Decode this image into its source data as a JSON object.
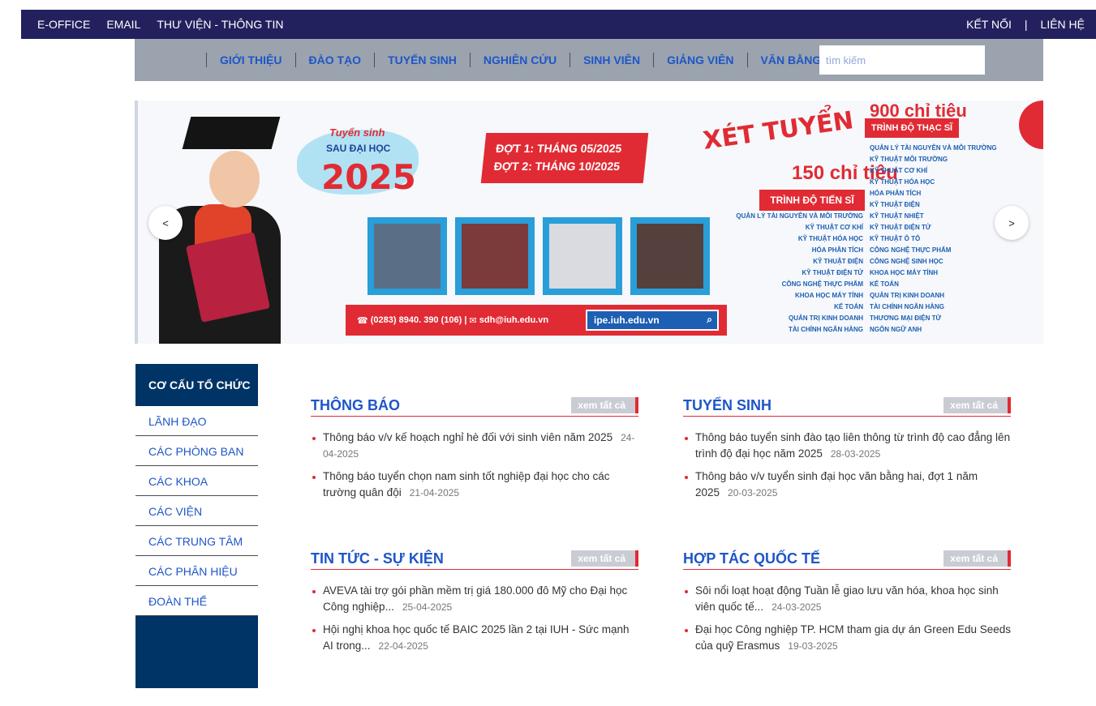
{
  "topbar": {
    "left": [
      "E-OFFICE",
      "EMAIL",
      "THƯ VIỆN - THÔNG TIN"
    ],
    "right": [
      "KẾT NỐI",
      "|",
      "LIÊN HỆ"
    ]
  },
  "nav": {
    "items": [
      "GIỚI THIỆU",
      "ĐÀO TẠO",
      "TUYỂN SINH",
      "NGHIÊN CỨU",
      "SINH VIÊN",
      "GIẢNG VIÊN",
      "VĂN BẰNG"
    ],
    "search_placeholder": "tìm kiếm"
  },
  "banner": {
    "title_top": "Tuyển sinh",
    "title_mid": "SAU ĐẠI HỌC",
    "year": "2025",
    "date1": "ĐỢT 1: THÁNG 05/2025",
    "date2": "ĐỢT 2: THÁNG 10/2025",
    "xet_tuyen": "XÉT TUYỂN",
    "ts_count": "150 chỉ tiêu",
    "ts_label": "TRÌNH ĐỘ TIẾN SĨ",
    "ths_count": "900 chỉ tiêu",
    "ths_label": "TRÌNH ĐỘ THẠC SĨ",
    "phone": "(0283) 8940. 390 (106)",
    "email": "sdh@iuh.edu.vn",
    "web": "ipe.iuh.edu.vn",
    "ts_list": [
      "QUẢN LÝ TÀI NGUYÊN VÀ MÔI TRƯỜNG",
      "KỸ THUẬT CƠ KHÍ",
      "KỸ THUẬT HÓA HỌC",
      "HÓA PHÂN TÍCH",
      "KỸ THUẬT ĐIỆN",
      "KỸ THUẬT ĐIỆN TỬ",
      "CÔNG NGHỆ THỰC PHẨM",
      "KHOA HỌC MÁY TÍNH",
      "KẾ TOÁN",
      "QUẢN TRỊ KINH DOANH",
      "TÀI CHÍNH NGÂN HÀNG"
    ],
    "ths_list": [
      "QUẢN LÝ TÀI NGUYÊN VÀ MÔI TRƯỜNG",
      "KỸ THUẬT MÔI TRƯỜNG",
      "KỸ THUẬT CƠ KHÍ",
      "KỸ THUẬT HÓA HỌC",
      "HÓA PHÂN TÍCH",
      "KỸ THUẬT ĐIỆN",
      "KỸ THUẬT NHIỆT",
      "KỸ THUẬT ĐIỆN TỬ",
      "KỸ THUẬT Ô TÔ",
      "CÔNG NGHỆ THỰC PHẨM",
      "CÔNG NGHỆ SINH HỌC",
      "KHOA HỌC MÁY TÍNH",
      "KẾ TOÁN",
      "QUẢN TRỊ KINH DOANH",
      "TÀI CHÍNH NGÂN HÀNG",
      "THƯƠNG MẠI ĐIỆN TỬ",
      "NGÔN NGỮ ANH"
    ],
    "prev": "<",
    "next": ">"
  },
  "sidebar": {
    "heading": "CƠ CẤU TỔ CHỨC",
    "links": [
      "LÃNH ĐẠO",
      "CÁC PHÒNG BAN",
      "CÁC KHOA",
      "CÁC VIỆN",
      "CÁC TRUNG TÂM",
      "CÁC PHÂN HIỆU",
      "ĐOÀN THỂ"
    ]
  },
  "sections": [
    {
      "title": "THÔNG BÁO",
      "more": "xem tất cả",
      "items": [
        {
          "text": "Thông báo v/v kế hoạch nghỉ hè đối với sinh viên năm 2025",
          "date": "24-04-2025"
        },
        {
          "text": "Thông báo tuyển chọn nam sinh tốt nghiệp đại học cho các trường quân đội",
          "date": "21-04-2025"
        }
      ]
    },
    {
      "title": "TUYỂN SINH",
      "more": "xem tất cả",
      "items": [
        {
          "text": "Thông báo tuyển sinh đào tạo liên thông từ trình độ cao đẳng lên trình độ đại học năm 2025",
          "date": "28-03-2025"
        },
        {
          "text": "Thông báo v/v tuyển sinh đại học văn bằng hai, đợt 1 năm 2025",
          "date": "20-03-2025"
        }
      ]
    },
    {
      "title": "TIN TỨC - SỰ KIỆN",
      "more": "xem tất cả",
      "items": [
        {
          "text": "AVEVA tài trợ gói phần mềm trị giá 180.000 đô Mỹ cho Đại học Công nghiệp...",
          "date": "25-04-2025"
        },
        {
          "text": "Hội nghị khoa học quốc tế BAIC 2025 lần 2 tại IUH - Sức mạnh AI trong...",
          "date": "22-04-2025"
        }
      ]
    },
    {
      "title": "HỢP TÁC QUỐC TẾ",
      "more": "xem tất cả",
      "items": [
        {
          "text": "Sôi nổi loạt hoạt động Tuần lễ giao lưu văn hóa, khoa học sinh viên quốc tế...",
          "date": "24-03-2025"
        },
        {
          "text": "Đại học Công nghiệp TP. HCM tham gia dự án Green Edu Seeds của quỹ Erasmus",
          "date": "19-03-2025"
        }
      ]
    }
  ]
}
